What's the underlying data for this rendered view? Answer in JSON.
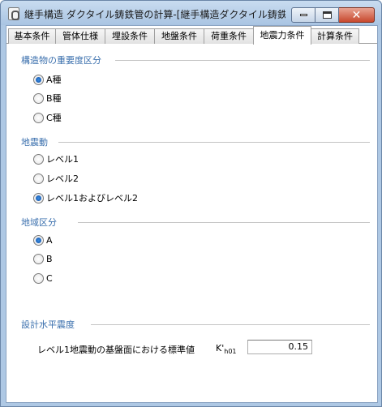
{
  "window": {
    "title": "継手構造 ダクタイル鋳鉄管の計算-[継手構造ダクタイル鋳鉄管の...",
    "minimize_icon": "minimize-icon",
    "maximize_icon": "maximize-icon",
    "close_icon": "close-icon"
  },
  "tabs": [
    {
      "label": "基本条件"
    },
    {
      "label": "管体仕様"
    },
    {
      "label": "埋設条件"
    },
    {
      "label": "地盤条件"
    },
    {
      "label": "荷重条件"
    },
    {
      "label": "地震力条件",
      "active": true
    },
    {
      "label": "計算条件"
    }
  ],
  "groups": {
    "importance": {
      "title": "構造物の重要度区分",
      "options": [
        "A種",
        "B種",
        "C種"
      ],
      "selected": "A種"
    },
    "seismic": {
      "title": "地震動",
      "options": [
        "レベル1",
        "レベル2",
        "レベル1およびレベル2"
      ],
      "selected": "レベル1およびレベル2"
    },
    "region": {
      "title": "地域区分",
      "options": [
        "A",
        "B",
        "C"
      ],
      "selected": "A"
    },
    "design": {
      "title": "設計水平震度",
      "field_label": "レベル1地震動の基盤面における標準値",
      "symbol_main": "K'",
      "symbol_sub": "h01",
      "value": "0.15"
    }
  },
  "colors": {
    "group_title": "#3a6fad",
    "radio_selected": "#0f4fa8",
    "frame": "#aec8e4"
  }
}
